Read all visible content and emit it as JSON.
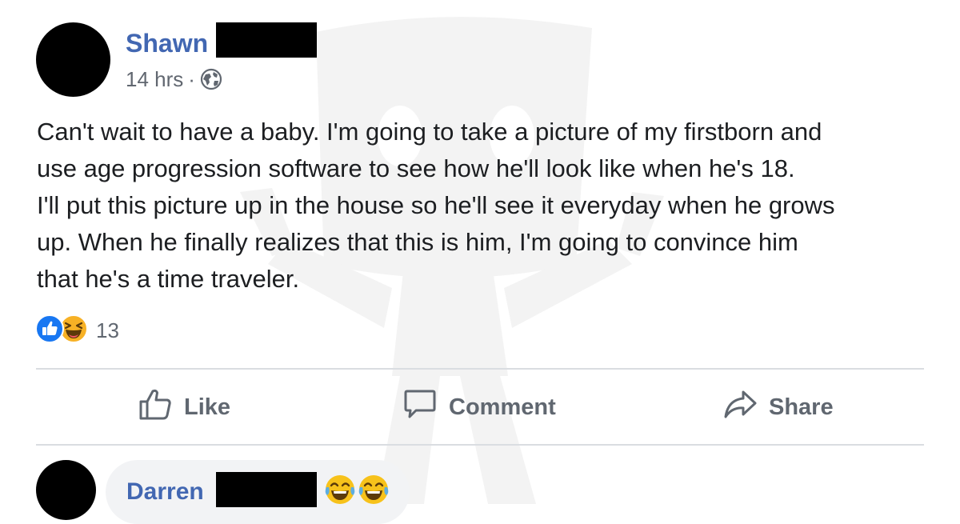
{
  "post": {
    "author_name": "Shawn",
    "timestamp": "14 hrs",
    "separator": "·",
    "privacy_icon": "globe-icon",
    "text_lines": [
      "Can't wait to have a baby. I'm going to take a picture of my firstborn and",
      "use age progression software to see how he'll look like when he's 18.",
      "I'll put this picture up in the house so he'll see it everyday when he grows",
      "up. When he finally realizes that this is him, I'm going to convince him",
      "that he's a time traveler."
    ],
    "reactions": {
      "icons": [
        "like-reaction-icon",
        "haha-reaction-icon"
      ],
      "count": "13"
    }
  },
  "actions": {
    "like_label": "Like",
    "comment_label": "Comment",
    "share_label": "Share"
  },
  "comment": {
    "author_name": "Darren",
    "emojis": [
      "tears-of-joy-emoji",
      "tears-of-joy-emoji"
    ]
  },
  "colors": {
    "name_blue": "#4267b2",
    "like_blue": "#1877f2",
    "meta_gray": "#606770",
    "divider": "#dadde1",
    "bubble": "#f2f3f5"
  }
}
